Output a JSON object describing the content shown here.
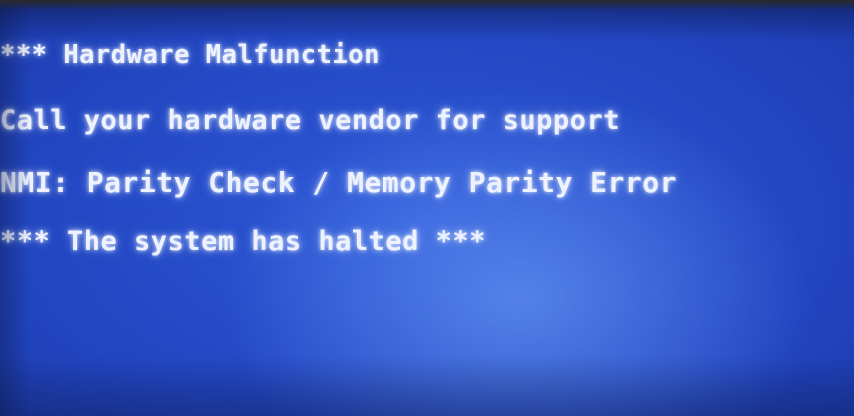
{
  "bsod": {
    "lines": [
      "*** Hardware Malfunction",
      "Call your hardware vendor for support",
      "NMI: Parity Check / Memory Parity Error",
      "*** The system has halted ***"
    ]
  }
}
